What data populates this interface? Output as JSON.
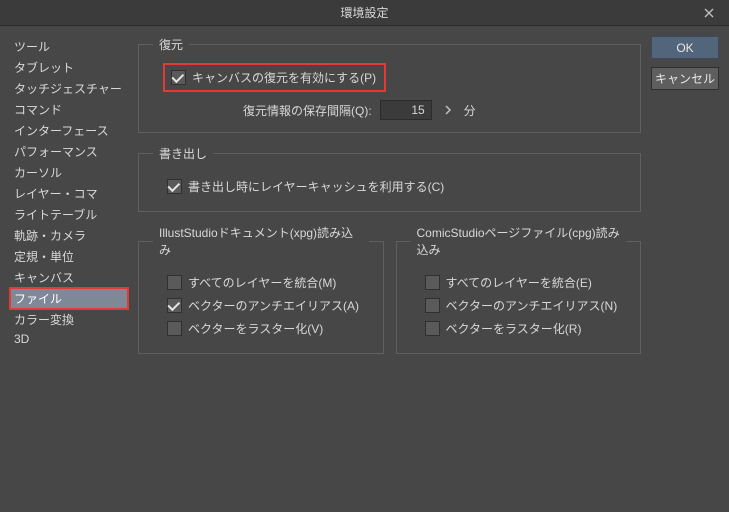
{
  "window": {
    "title": "環境設定"
  },
  "sidebar": {
    "items": [
      {
        "label": "ツール"
      },
      {
        "label": "タブレット"
      },
      {
        "label": "タッチジェスチャー"
      },
      {
        "label": "コマンド"
      },
      {
        "label": "インターフェース"
      },
      {
        "label": "パフォーマンス"
      },
      {
        "label": "カーソル"
      },
      {
        "label": "レイヤー・コマ"
      },
      {
        "label": "ライトテーブル"
      },
      {
        "label": "軌跡・カメラ"
      },
      {
        "label": "定規・単位"
      },
      {
        "label": "キャンバス"
      },
      {
        "label": "ファイル"
      },
      {
        "label": "カラー変換"
      },
      {
        "label": "3D"
      }
    ],
    "selected_index": 12
  },
  "buttons": {
    "ok": "OK",
    "cancel": "キャンセル"
  },
  "restore": {
    "legend": "復元",
    "enable_label": "キャンバスの復元を有効にする(P)",
    "enable_checked": true,
    "interval_label": "復元情報の保存間隔(Q):",
    "interval_value": "15",
    "interval_unit": "分"
  },
  "export": {
    "legend": "書き出し",
    "layer_cache_label": "書き出し時にレイヤーキャッシュを利用する(C)",
    "layer_cache_checked": true
  },
  "xpg": {
    "legend": "IllustStudioドキュメント(xpg)読み込み",
    "merge_label": "すべてのレイヤーを統合(M)",
    "merge_checked": false,
    "aa_label": "ベクターのアンチエイリアス(A)",
    "aa_checked": true,
    "raster_label": "ベクターをラスター化(V)",
    "raster_checked": false
  },
  "cpg": {
    "legend": "ComicStudioページファイル(cpg)読み込み",
    "merge_label": "すべてのレイヤーを統合(E)",
    "merge_checked": false,
    "aa_label": "ベクターのアンチエイリアス(N)",
    "aa_checked": false,
    "raster_label": "ベクターをラスター化(R)",
    "raster_checked": false
  }
}
